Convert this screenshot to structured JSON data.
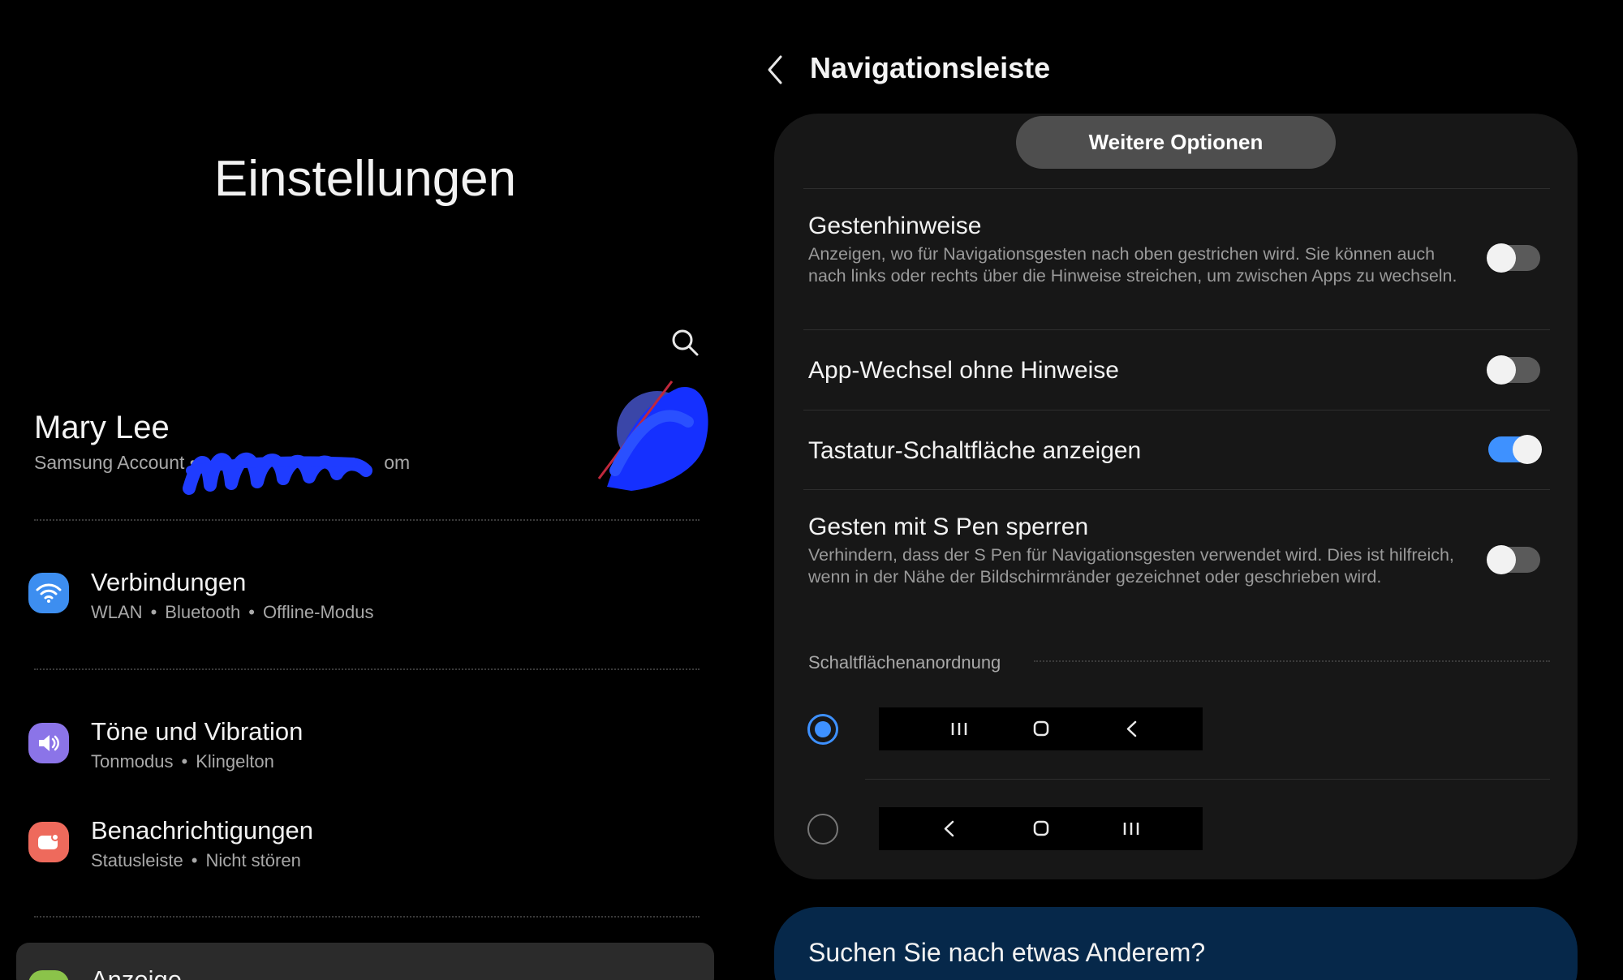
{
  "left": {
    "title": "Einstellungen",
    "profile": {
      "name": "Mary Lee",
      "account_label": "Samsung Account",
      "account_separator": "•",
      "account_tail": "om"
    },
    "menu": [
      {
        "label": "Verbindungen",
        "sub": [
          "WLAN",
          "Bluetooth",
          "Offline-Modus"
        ],
        "icon": "wifi-icon",
        "color": "#3d8ef0"
      },
      {
        "label": "Töne und Vibration",
        "sub": [
          "Tonmodus",
          "Klingelton"
        ],
        "icon": "speaker-icon",
        "color": "#8b74e8"
      },
      {
        "label": "Benachrichtigungen",
        "sub": [
          "Statusleiste",
          "Nicht stören"
        ],
        "icon": "notification-icon",
        "color": "#ee6a5c"
      },
      {
        "label": "Anzeige",
        "icon": "display-icon",
        "color": "#8bc34a"
      }
    ],
    "sub_separator": "•"
  },
  "right": {
    "title": "Navigationsleiste",
    "more_button": "Weitere Optionen",
    "options": [
      {
        "title": "Gestenhinweise",
        "desc": "Anzeigen, wo für Navigationsgesten nach oben gestrichen wird. Sie können auch nach links oder rechts über die Hinweise streichen, um zwischen Apps zu wechseln.",
        "enabled": false
      },
      {
        "title": "App-Wechsel ohne Hinweise",
        "enabled": false
      },
      {
        "title": "Tastatur-Schaltfläche anzeigen",
        "enabled": true
      },
      {
        "title": "Gesten mit S Pen sperren",
        "desc": "Verhindern, dass der S Pen für Navigationsgesten verwendet wird. Dies ist hilfreich, wenn in der Nähe der Bildschirmränder gezeichnet oder geschrieben wird.",
        "enabled": false
      }
    ],
    "button_order_label": "Schaltflächenanordnung",
    "button_orders": [
      {
        "selected": true,
        "buttons": [
          "recents-icon",
          "home-icon",
          "back-icon"
        ]
      },
      {
        "selected": false,
        "buttons": [
          "back-icon",
          "home-icon",
          "recents-icon"
        ]
      }
    ],
    "suggest": "Suchen Sie nach etwas Anderem?"
  },
  "colors": {
    "accent": "#3e91ff",
    "card": "#171717",
    "suggest_card": "#06284a"
  }
}
